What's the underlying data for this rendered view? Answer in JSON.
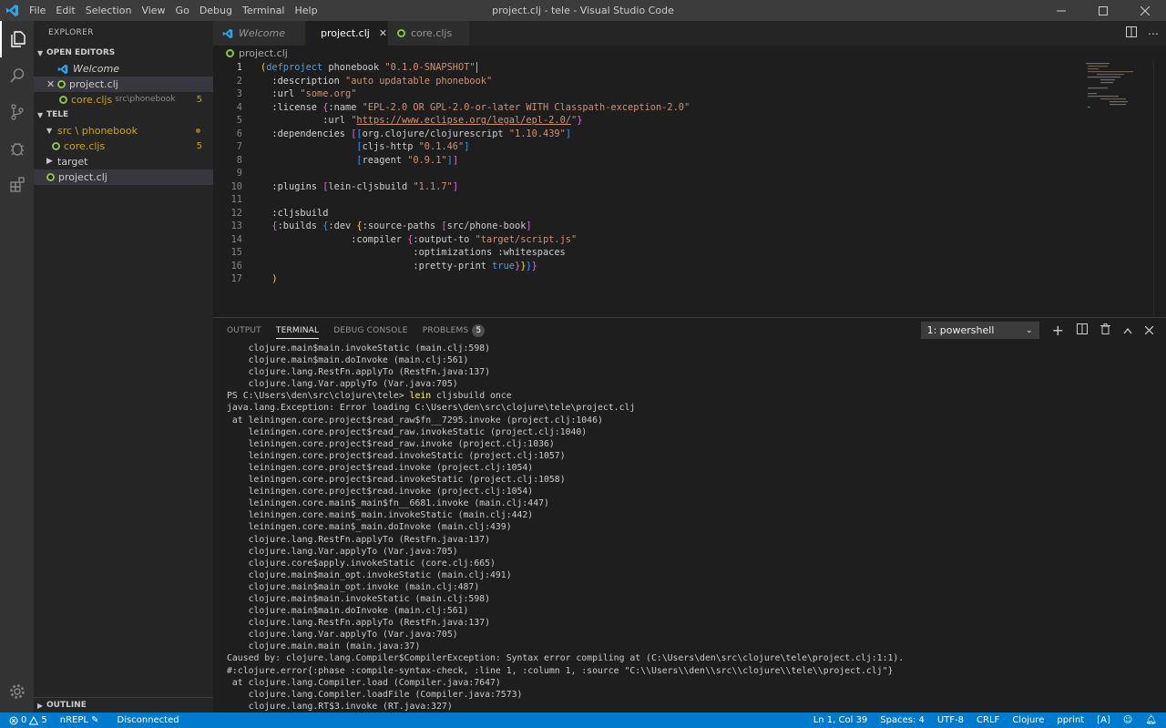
{
  "window": {
    "title": "project.clj - tele - Visual Studio Code",
    "menu": [
      "File",
      "Edit",
      "Selection",
      "View",
      "Go",
      "Debug",
      "Terminal",
      "Help"
    ]
  },
  "sidebar": {
    "header": "EXPLORER",
    "open_editors": {
      "label": "OPEN EDITORS",
      "items": [
        {
          "name": "Welcome"
        },
        {
          "name": "project.clj"
        },
        {
          "name": "core.cljs",
          "path": "src\\phonebook",
          "badge": "5"
        }
      ]
    },
    "workspace": {
      "label": "TELE",
      "items": [
        {
          "name": "src \\ phonebook"
        },
        {
          "name": "core.cljs",
          "badge": "5"
        },
        {
          "name": "target"
        },
        {
          "name": "project.clj"
        }
      ]
    },
    "outline_label": "OUTLINE"
  },
  "tabs": [
    {
      "label": "Welcome"
    },
    {
      "label": "project.clj"
    },
    {
      "label": "core.cljs"
    }
  ],
  "breadcrumb": "project.clj",
  "editor": {
    "line_numbers": [
      "1",
      "2",
      "3",
      "4",
      "5",
      "6",
      "7",
      "8",
      "9",
      "10",
      "11",
      "12",
      "13",
      "14",
      "15",
      "16",
      "17"
    ]
  },
  "panel": {
    "tabs": [
      "OUTPUT",
      "TERMINAL",
      "DEBUG CONSOLE",
      "PROBLEMS"
    ],
    "problems_count": "5",
    "terminal_select": "1: powershell",
    "terminal_lines": [
      "    clojure.main$main.invokeStatic (main.clj:598)",
      "    clojure.main$main.doInvoke (main.clj:561)",
      "    clojure.lang.RestFn.applyTo (RestFn.java:137)",
      "    clojure.lang.Var.applyTo (Var.java:705)",
      "PS C:\\Users\\den\\src\\clojure\\tele> lein cljsbuild once",
      "java.lang.Exception: Error loading C:\\Users\\den\\src\\clojure\\tele\\project.clj",
      " at leiningen.core.project$read_raw$fn__7295.invoke (project.clj:1046)",
      "    leiningen.core.project$read_raw.invokeStatic (project.clj:1040)",
      "    leiningen.core.project$read_raw.invoke (project.clj:1036)",
      "    leiningen.core.project$read.invokeStatic (project.clj:1057)",
      "    leiningen.core.project$read.invoke (project.clj:1054)",
      "    leiningen.core.project$read.invokeStatic (project.clj:1058)",
      "    leiningen.core.project$read.invoke (project.clj:1054)",
      "    leiningen.core.main$_main$fn__6681.invoke (main.clj:447)",
      "    leiningen.core.main$_main.invokeStatic (main.clj:442)",
      "    leiningen.core.main$_main.doInvoke (main.clj:439)",
      "    clojure.lang.RestFn.applyTo (RestFn.java:137)",
      "    clojure.lang.Var.applyTo (Var.java:705)",
      "    clojure.core$apply.invokeStatic (core.clj:665)",
      "    clojure.main$main_opt.invokeStatic (main.clj:491)",
      "    clojure.main$main_opt.invoke (main.clj:487)",
      "    clojure.main$main.invokeStatic (main.clj:598)",
      "    clojure.main$main.doInvoke (main.clj:561)",
      "    clojure.lang.RestFn.applyTo (RestFn.java:137)",
      "    clojure.lang.Var.applyTo (Var.java:705)",
      "    clojure.main.main (main.java:37)",
      "Caused by: clojure.lang.Compiler$CompilerException: Syntax error compiling at (C:\\Users\\den\\src\\clojure\\tele\\project.clj:1:1).",
      "#:clojure.error{:phase :compile-syntax-check, :line 1, :column 1, :source \"C:\\\\Users\\\\den\\\\src\\\\clojure\\\\tele\\\\project.clj\"}",
      " at clojure.lang.Compiler.load (Compiler.java:7647)",
      "    clojure.lang.Compiler.loadFile (Compiler.java:7573)",
      "    clojure.lang.RT$3.invoke (RT.java:327)"
    ]
  },
  "statusbar": {
    "errors": "0",
    "warnings": "5",
    "nrepl": "nREPL",
    "connection": "Disconnected",
    "position": "Ln 1, Col 39",
    "spaces": "Spaces: 4",
    "encoding": "UTF-8",
    "eol": "CRLF",
    "language": "Clojure",
    "pprint": "pprint",
    "mode": "[A]"
  },
  "colors": {
    "accent": "#007acc",
    "clojure_green": "#8dc149",
    "vscode_blue": "#23a9f2"
  }
}
